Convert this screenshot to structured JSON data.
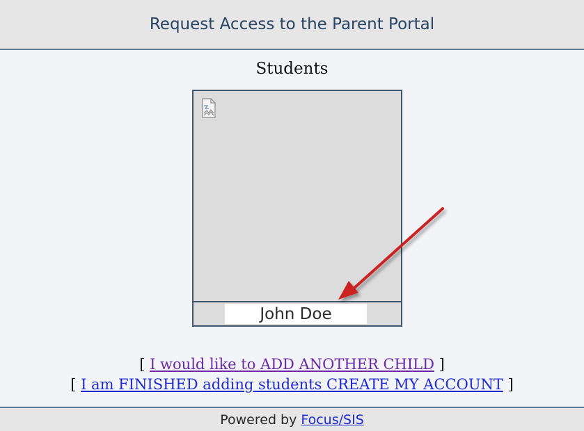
{
  "header": {
    "title": "Request Access to the Parent Portal"
  },
  "students": {
    "heading": "Students",
    "cards": [
      {
        "name": "John Doe",
        "photo_icon": "broken-image-icon"
      }
    ]
  },
  "annotation": {
    "arrow_color": "#cc2222",
    "arrow_icon": "red-arrow-pointer"
  },
  "links": {
    "open_bracket": "[",
    "close_bracket": "]",
    "add_child": "I would like to ADD ANOTHER CHILD",
    "finish": "I am FINISHED adding students CREATE MY ACCOUNT"
  },
  "footer": {
    "prefix": "Powered by",
    "link_label": "Focus/SIS"
  },
  "colors": {
    "link": "#1f2bd0",
    "visited_link": "#6a2aa3",
    "header_text": "#274563",
    "border": "#5c7b97"
  }
}
